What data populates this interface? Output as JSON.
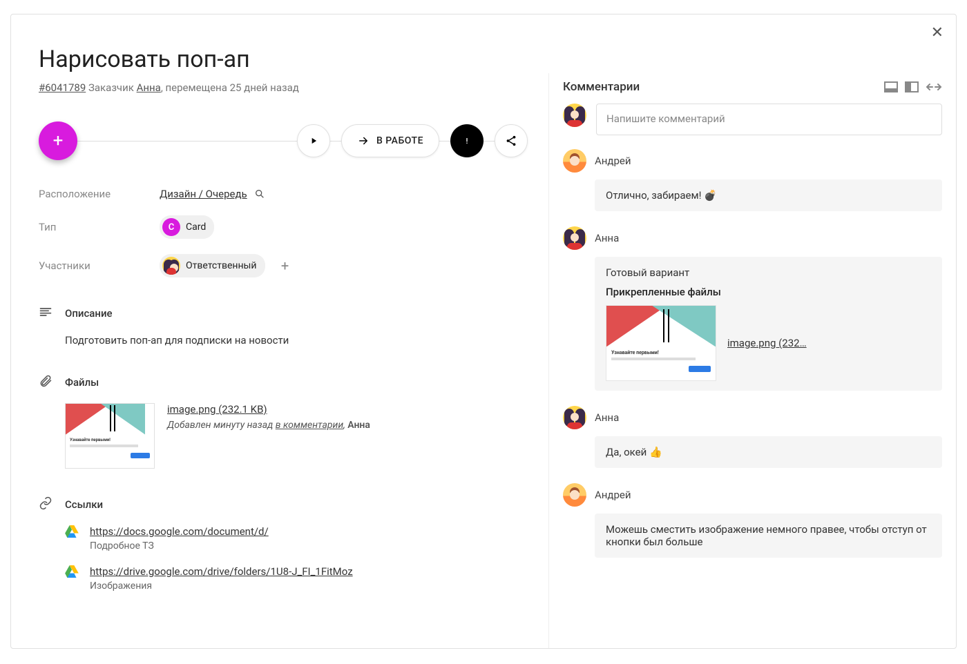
{
  "card": {
    "title": "Нарисовать поп-ап",
    "id_label": "#6041789",
    "requester_label": "Заказчик",
    "requester_name": "Анна",
    "moved_label": ", перемещена 25 дней назад",
    "status_button": "В РАБОТЕ"
  },
  "fields": {
    "location_label": "Расположение",
    "location_value": "Дизайн / Очередь",
    "type_label": "Тип",
    "type_badge": "C",
    "type_value": "Card",
    "members_label": "Участники",
    "members_value": "Ответственный"
  },
  "sections": {
    "description_title": "Описание",
    "description_body": "Подготовить поп-ап для подписки на новости",
    "files_title": "Файлы",
    "file_name": "image.png (232.1 KB)",
    "file_added_prefix": "Добавлен минуту назад ",
    "file_added_link": "в комментарии",
    "file_added_sep": ", ",
    "file_added_by": "Анна",
    "links_title": "Ссылки",
    "link1_url": "https://docs.google.com/document/d/",
    "link1_desc": "Подробное ТЗ",
    "link2_url": "https://drive.google.com/drive/folders/1U8-J_FI_1FitMoz",
    "link2_desc": "Изображения",
    "thumb_caption": "Узнавайте первыми!"
  },
  "comments": {
    "title": "Комментарии",
    "placeholder": "Напишите комментарий",
    "items": [
      {
        "author": "Андрей",
        "body": "Отлично, забираем! 💣"
      },
      {
        "author": "Анна",
        "body": "Готовый вариант",
        "attach_title": "Прикрепленные файлы",
        "attach_link": "image.png (232…"
      },
      {
        "author": "Анна",
        "body": "Да, окей 👍"
      },
      {
        "author": "Андрей",
        "body": "Можешь сместить изображение немного правее, чтобы отступ от кнопки был больше"
      }
    ]
  }
}
